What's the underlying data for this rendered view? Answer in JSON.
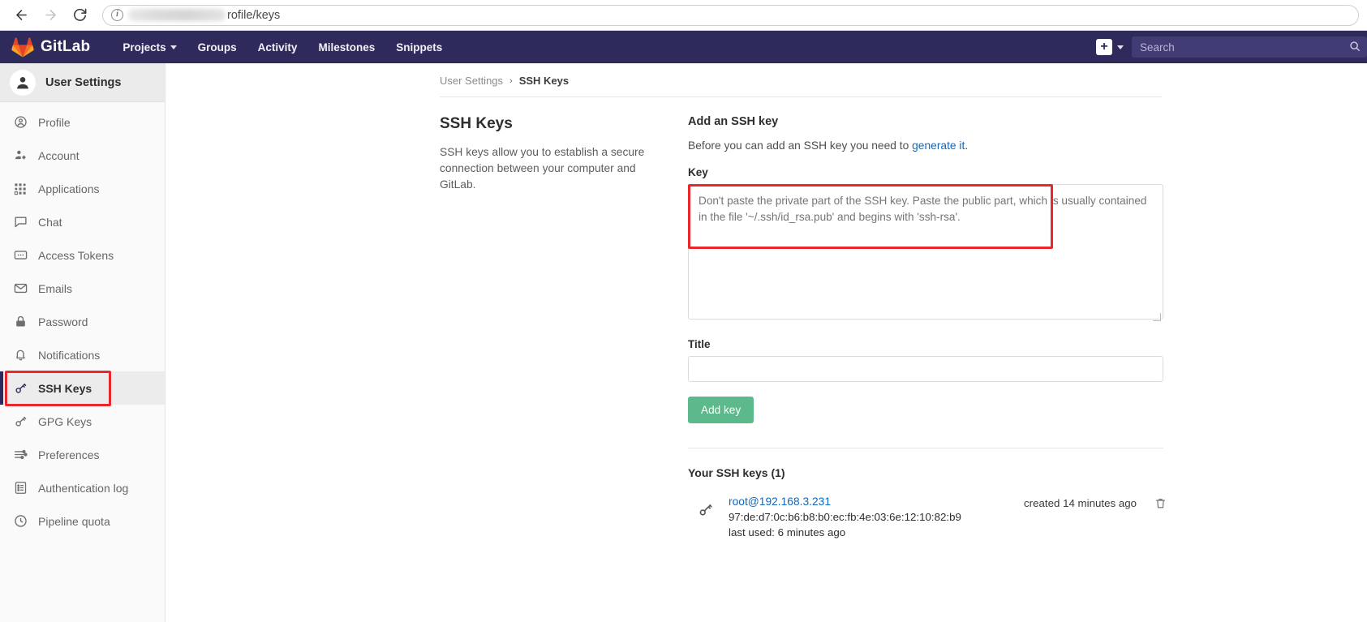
{
  "browser": {
    "back_icon": "arrow-left-icon",
    "forward_icon": "arrow-right-icon",
    "reload_icon": "reload-icon",
    "info_glyph": "i",
    "url_visible": "rofile/keys"
  },
  "navbar": {
    "brand": "GitLab",
    "items": [
      {
        "label": "Projects",
        "has_caret": true
      },
      {
        "label": "Groups",
        "has_caret": false
      },
      {
        "label": "Activity",
        "has_caret": false
      },
      {
        "label": "Milestones",
        "has_caret": false
      },
      {
        "label": "Snippets",
        "has_caret": false
      }
    ],
    "plus_label": "+",
    "search_placeholder": "Search",
    "background": "#2e2a5b"
  },
  "sidebar": {
    "header": "User Settings",
    "items": [
      {
        "label": "Profile",
        "icon": "user-circle-icon",
        "active": false
      },
      {
        "label": "Account",
        "icon": "user-gear-icon",
        "active": false
      },
      {
        "label": "Applications",
        "icon": "grid-apps-icon",
        "active": false
      },
      {
        "label": "Chat",
        "icon": "chat-bubble-icon",
        "active": false
      },
      {
        "label": "Access Tokens",
        "icon": "token-card-icon",
        "active": false
      },
      {
        "label": "Emails",
        "icon": "envelope-icon",
        "active": false
      },
      {
        "label": "Password",
        "icon": "lock-icon",
        "active": false
      },
      {
        "label": "Notifications",
        "icon": "bell-icon",
        "active": false
      },
      {
        "label": "SSH Keys",
        "icon": "key-icon",
        "active": true
      },
      {
        "label": "GPG Keys",
        "icon": "key-icon",
        "active": false
      },
      {
        "label": "Preferences",
        "icon": "sliders-icon",
        "active": false
      },
      {
        "label": "Authentication log",
        "icon": "list-document-icon",
        "active": false
      },
      {
        "label": "Pipeline quota",
        "icon": "clock-icon",
        "active": false
      }
    ]
  },
  "breadcrumb": {
    "parent": "User Settings",
    "separator": "›",
    "current": "SSH Keys"
  },
  "panel": {
    "heading": "SSH Keys",
    "description": "SSH keys allow you to establish a secure connection between your computer and GitLab."
  },
  "form": {
    "heading": "Add an SSH key",
    "note_before": "Before you can add an SSH key you need to ",
    "note_link": "generate it",
    "note_after": ".",
    "key_label": "Key",
    "key_placeholder": "Don't paste the private part of the SSH key. Paste the public part, which is usually contained in the file '~/.ssh/id_rsa.pub' and begins with 'ssh-rsa'.",
    "key_value": "",
    "title_label": "Title",
    "title_value": "",
    "title_placeholder": "",
    "submit_label": "Add key",
    "submit_color": "#5cb98b"
  },
  "keys_list": {
    "heading": "Your SSH keys (1)",
    "rows": [
      {
        "title": "root@192.168.3.231",
        "fingerprint": "97:de:d7:0c:b6:b8:b0:ec:fb:4e:03:6e:12:10:82:b9",
        "last_used": "last used: 6 minutes ago",
        "created": "created 14 minutes ago",
        "delete_icon": "trash-icon"
      }
    ]
  },
  "annotations": {
    "highlight_color": "#e8282a",
    "sidebar_target": "SSH Keys",
    "key_field_target": "Key"
  }
}
